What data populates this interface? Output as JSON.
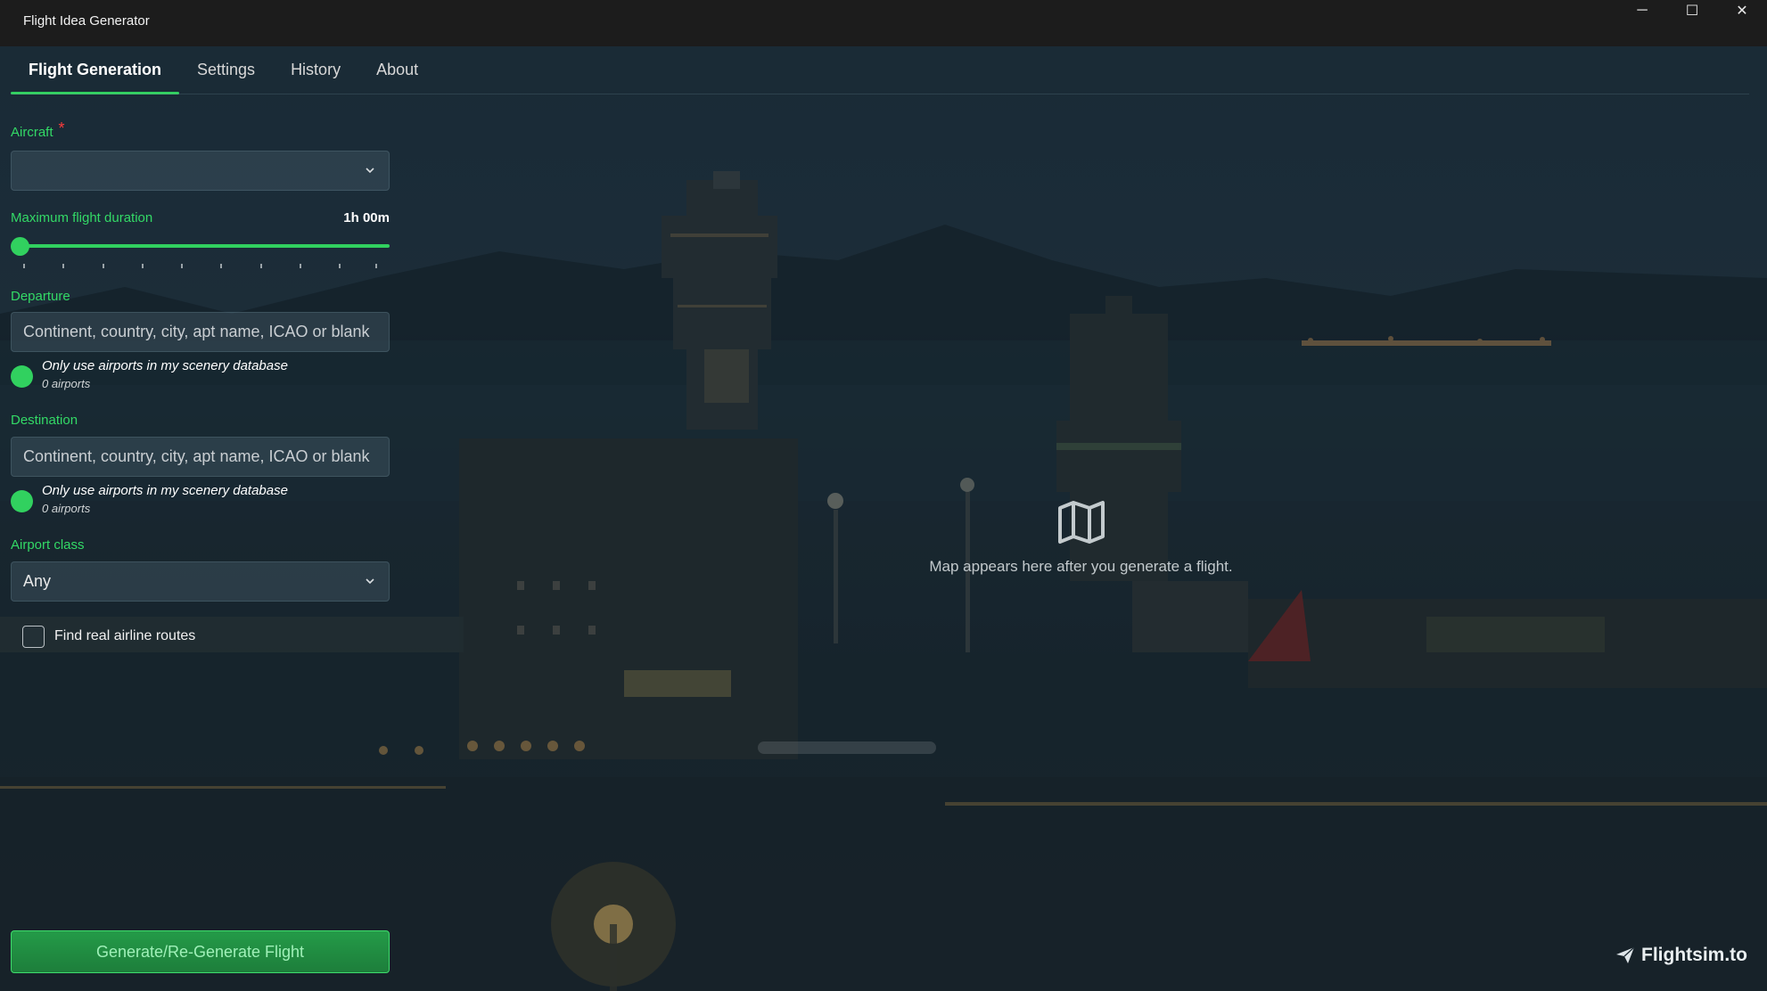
{
  "window": {
    "title": "Flight Idea Generator",
    "minimize_glyph": "─",
    "maximize_glyph": "☐",
    "close_glyph": "✕"
  },
  "tabs": [
    {
      "label": "Flight Generation",
      "active": true
    },
    {
      "label": "Settings",
      "active": false
    },
    {
      "label": "History",
      "active": false
    },
    {
      "label": "About",
      "active": false
    }
  ],
  "form": {
    "aircraft": {
      "label": "Aircraft",
      "required_mark": "*",
      "value": ""
    },
    "duration": {
      "label": "Maximum flight duration",
      "value_text": "1h 00m",
      "fraction": 0.0
    },
    "departure": {
      "label": "Departure",
      "placeholder": "Continent, country, city, apt name, ICAO or blank",
      "toggle_text": "Only use airports in my scenery database",
      "toggle_sub": "0 airports"
    },
    "destination": {
      "label": "Destination",
      "placeholder": "Continent, country, city, apt name, ICAO or blank",
      "toggle_text": "Only use airports in my scenery database",
      "toggle_sub": "0 airports"
    },
    "airport_class": {
      "label": "Airport class",
      "value": "Any"
    },
    "real_routes": {
      "label": "Find real airline routes",
      "checked": false
    },
    "generate_label": "Generate/Re-Generate Flight"
  },
  "map": {
    "placeholder_text": "Map appears here after you generate a flight.",
    "icon": "map-icon"
  },
  "brand": {
    "text": "Flightsim.to",
    "icon": "paper-plane-icon"
  },
  "colors": {
    "accent": "#31d15f",
    "required": "#ff3b3b",
    "titlebar": "#1c1c1c"
  }
}
